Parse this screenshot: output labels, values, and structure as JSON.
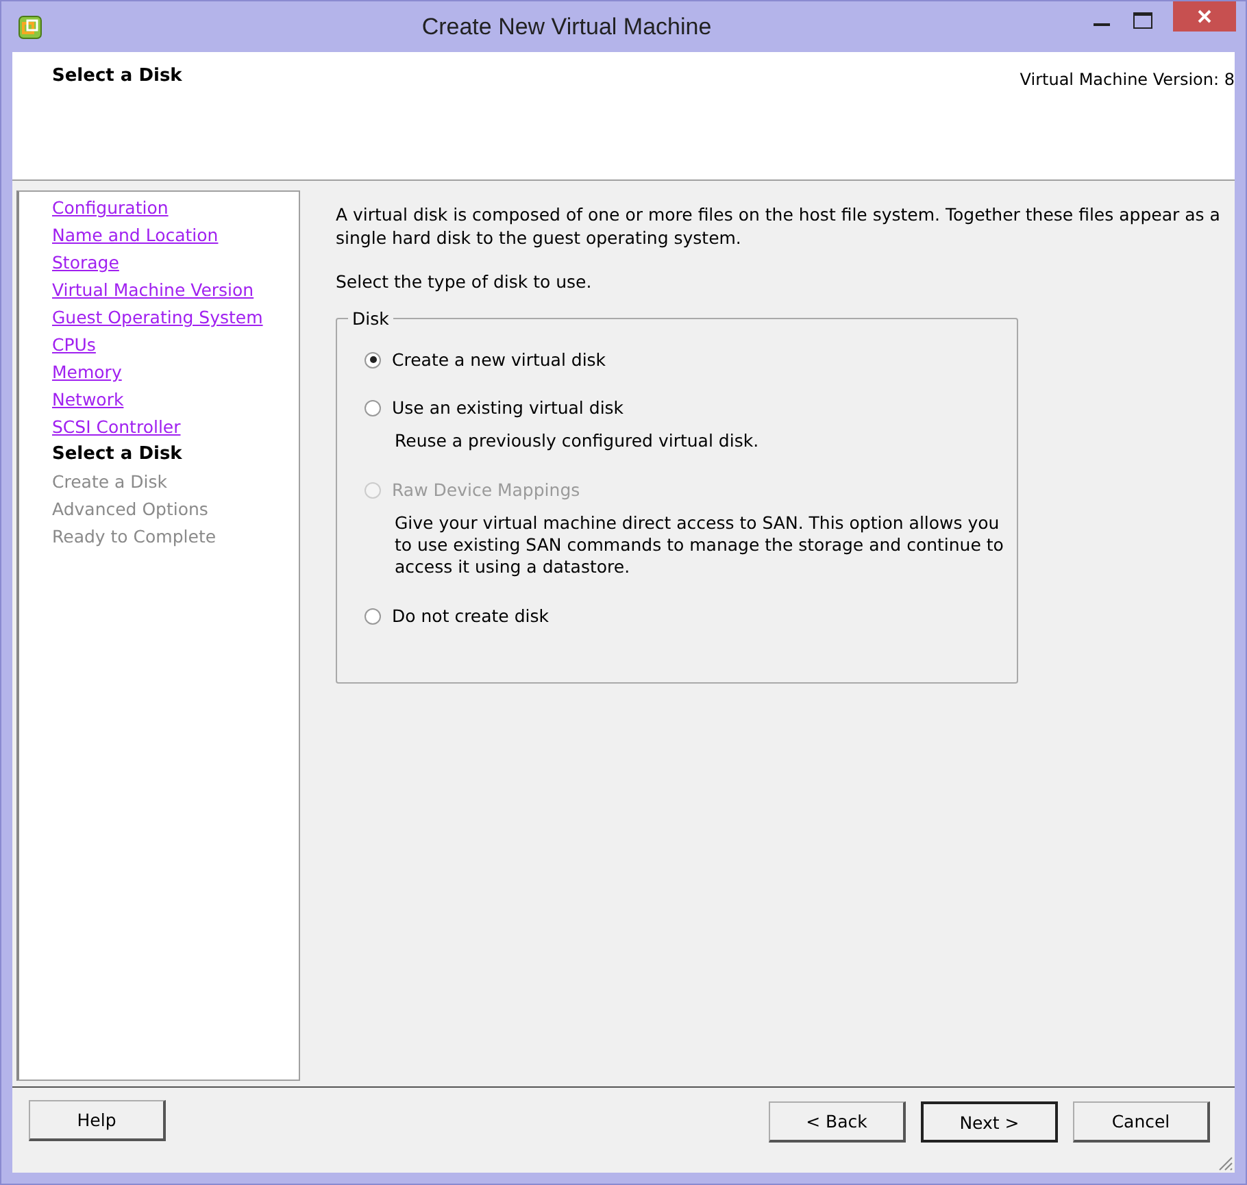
{
  "window": {
    "title": "Create New Virtual Machine"
  },
  "header": {
    "title": "Select a Disk",
    "version": "Virtual Machine Version: 8"
  },
  "steps": [
    {
      "label": "Configuration",
      "kind": "link"
    },
    {
      "label": "Name and Location",
      "kind": "link"
    },
    {
      "label": "Storage",
      "kind": "link"
    },
    {
      "label": "Virtual Machine Version",
      "kind": "link"
    },
    {
      "label": "Guest Operating System",
      "kind": "link"
    },
    {
      "label": "CPUs",
      "kind": "link"
    },
    {
      "label": "Memory",
      "kind": "link"
    },
    {
      "label": "Network",
      "kind": "link"
    },
    {
      "label": "SCSI Controller",
      "kind": "link"
    },
    {
      "label": "Select a Disk",
      "kind": "current"
    },
    {
      "label": "Create a Disk",
      "kind": "pending"
    },
    {
      "label": "Advanced Options",
      "kind": "pending"
    },
    {
      "label": "Ready to Complete",
      "kind": "pending"
    }
  ],
  "intro": "A virtual disk is composed of one or more files on the host file system. Together these files appear as a single hard disk to the guest operating system.",
  "prompt": "Select the type of disk to use.",
  "group": {
    "legend": "Disk",
    "options": [
      {
        "label": "Create a new virtual disk",
        "selected": true,
        "disabled": false
      },
      {
        "label": "Use an existing virtual disk",
        "selected": false,
        "disabled": false,
        "description": "Reuse a previously configured virtual disk."
      },
      {
        "label": "Raw Device Mappings",
        "selected": false,
        "disabled": true,
        "description": "Give your virtual machine direct access to SAN. This option allows you to use existing SAN commands to manage the storage and continue to access it using a datastore."
      },
      {
        "label": "Do not create disk",
        "selected": false,
        "disabled": false
      }
    ]
  },
  "buttons": {
    "left": [
      {
        "label": "Help",
        "default": false
      }
    ],
    "right": [
      {
        "label": "< Back",
        "default": false
      },
      {
        "label": "Next >",
        "default": true
      },
      {
        "label": "Cancel",
        "default": false
      }
    ]
  }
}
